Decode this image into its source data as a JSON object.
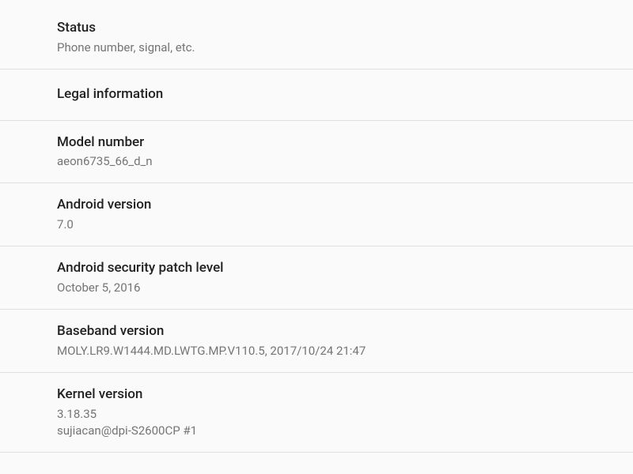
{
  "settings": {
    "items": [
      {
        "title": "Status",
        "subtitle": "Phone number, signal, etc."
      },
      {
        "title": "Legal information",
        "subtitle": ""
      },
      {
        "title": "Model number",
        "subtitle": "aeon6735_66_d_n"
      },
      {
        "title": "Android version",
        "subtitle": "7.0"
      },
      {
        "title": "Android security patch level",
        "subtitle": "October 5, 2016"
      },
      {
        "title": "Baseband version",
        "subtitle": "MOLY.LR9.W1444.MD.LWTG.MP.V110.5, 2017/10/24 21:47"
      },
      {
        "title": "Kernel version",
        "subtitle": "3.18.35",
        "subtitle2": "sujiacan@dpi-S2600CP #1"
      }
    ]
  }
}
